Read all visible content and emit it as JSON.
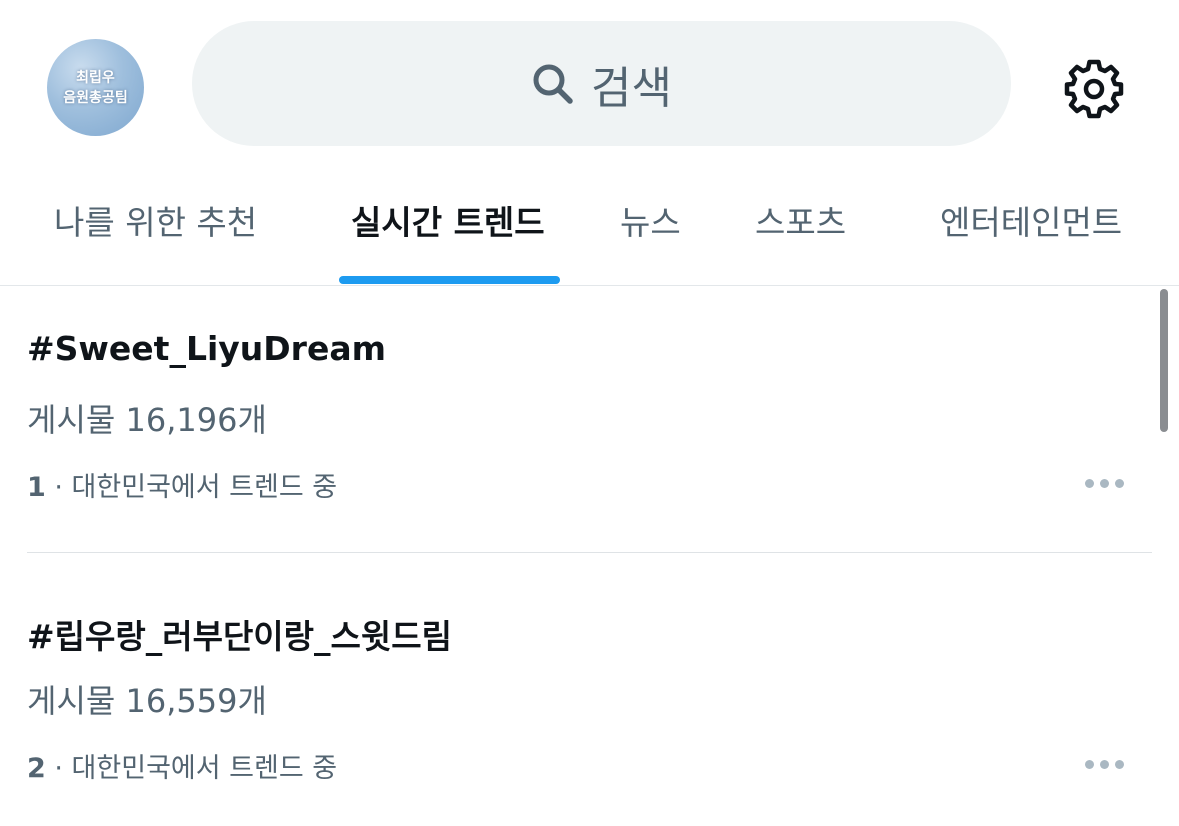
{
  "header": {
    "avatar_text": "최립우\n음원총공팀",
    "search_placeholder": "검색",
    "icons": {
      "search": "search-icon",
      "settings": "gear-icon"
    }
  },
  "tabs": [
    {
      "label": "나를 위한 추천",
      "active": false
    },
    {
      "label": "실시간 트렌드",
      "active": true
    },
    {
      "label": "뉴스",
      "active": false
    },
    {
      "label": "스포츠",
      "active": false
    },
    {
      "label": "엔터테인먼트",
      "active": false
    }
  ],
  "trends": [
    {
      "rank": "1",
      "title": "#Sweet_LiyuDream",
      "posts": "게시물 16,196개",
      "location": " · 대한민국에서 트렌드 중"
    },
    {
      "rank": "2",
      "title": "#립우랑_러부단이랑_스윗드림",
      "posts": "게시물 16,559개",
      "location": " · 대한민국에서 트렌드 중"
    }
  ],
  "colors": {
    "accent": "#1d9bf0",
    "primary_text": "#0f1419",
    "secondary_text": "#536471",
    "search_bg": "#eff3f4"
  }
}
